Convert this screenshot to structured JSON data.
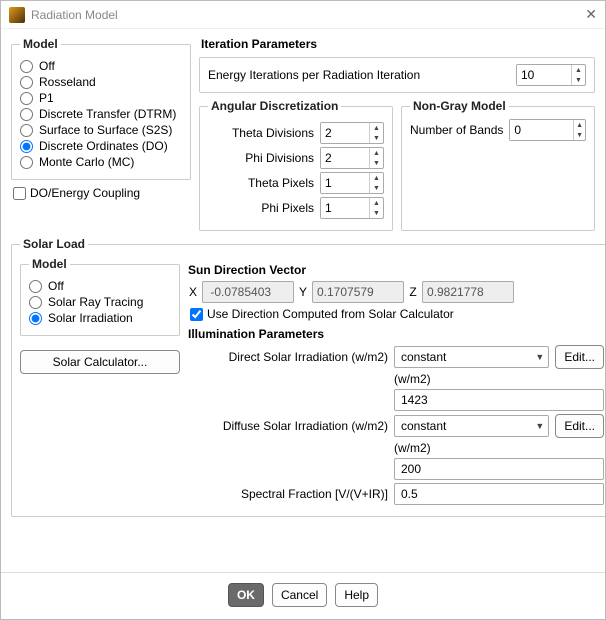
{
  "window": {
    "title": "Radiation Model"
  },
  "model": {
    "legend": "Model",
    "options": [
      "Off",
      "Rosseland",
      "P1",
      "Discrete Transfer (DTRM)",
      "Surface to Surface (S2S)",
      "Discrete Ordinates (DO)",
      "Monte Carlo (MC)"
    ],
    "selected": "Discrete Ordinates (DO)",
    "do_energy_label": "DO/Energy Coupling",
    "do_energy_checked": false
  },
  "iteration": {
    "heading": "Iteration Parameters",
    "label": "Energy Iterations per Radiation Iteration",
    "value": "10"
  },
  "angular": {
    "legend": "Angular Discretization",
    "theta_div_label": "Theta Divisions",
    "theta_div": "2",
    "phi_div_label": "Phi Divisions",
    "phi_div": "2",
    "theta_px_label": "Theta Pixels",
    "theta_px": "1",
    "phi_px_label": "Phi Pixels",
    "phi_px": "1"
  },
  "nongray": {
    "legend": "Non-Gray Model",
    "bands_label": "Number of Bands",
    "bands": "0"
  },
  "solar": {
    "legend": "Solar Load",
    "model_legend": "Model",
    "options": [
      "Off",
      "Solar Ray Tracing",
      "Solar Irradiation"
    ],
    "selected": "Solar Irradiation",
    "calc_btn": "Solar Calculator...",
    "sun_vec_heading": "Sun Direction Vector",
    "x_lbl": "X",
    "y_lbl": "Y",
    "z_lbl": "Z",
    "x": " -0.0785403",
    "y": "0.1707579",
    "z": "0.9821778",
    "use_calc_label": "Use Direction Computed from Solar Calculator",
    "use_calc_checked": true,
    "illum_heading": "Illumination Parameters",
    "direct_label": "Direct Solar Irradiation (w/m2)",
    "direct_method": "constant",
    "direct_unit": "(w/m2)",
    "direct_value": "1423",
    "diffuse_label": "Diffuse Solar Irradiation (w/m2)",
    "diffuse_method": "constant",
    "diffuse_unit": "(w/m2)",
    "diffuse_value": "200",
    "spectral_label": "Spectral Fraction [V/(V+IR)]",
    "spectral_value": "0.5",
    "edit_btn": "Edit..."
  },
  "buttons": {
    "ok": "OK",
    "cancel": "Cancel",
    "help": "Help"
  }
}
